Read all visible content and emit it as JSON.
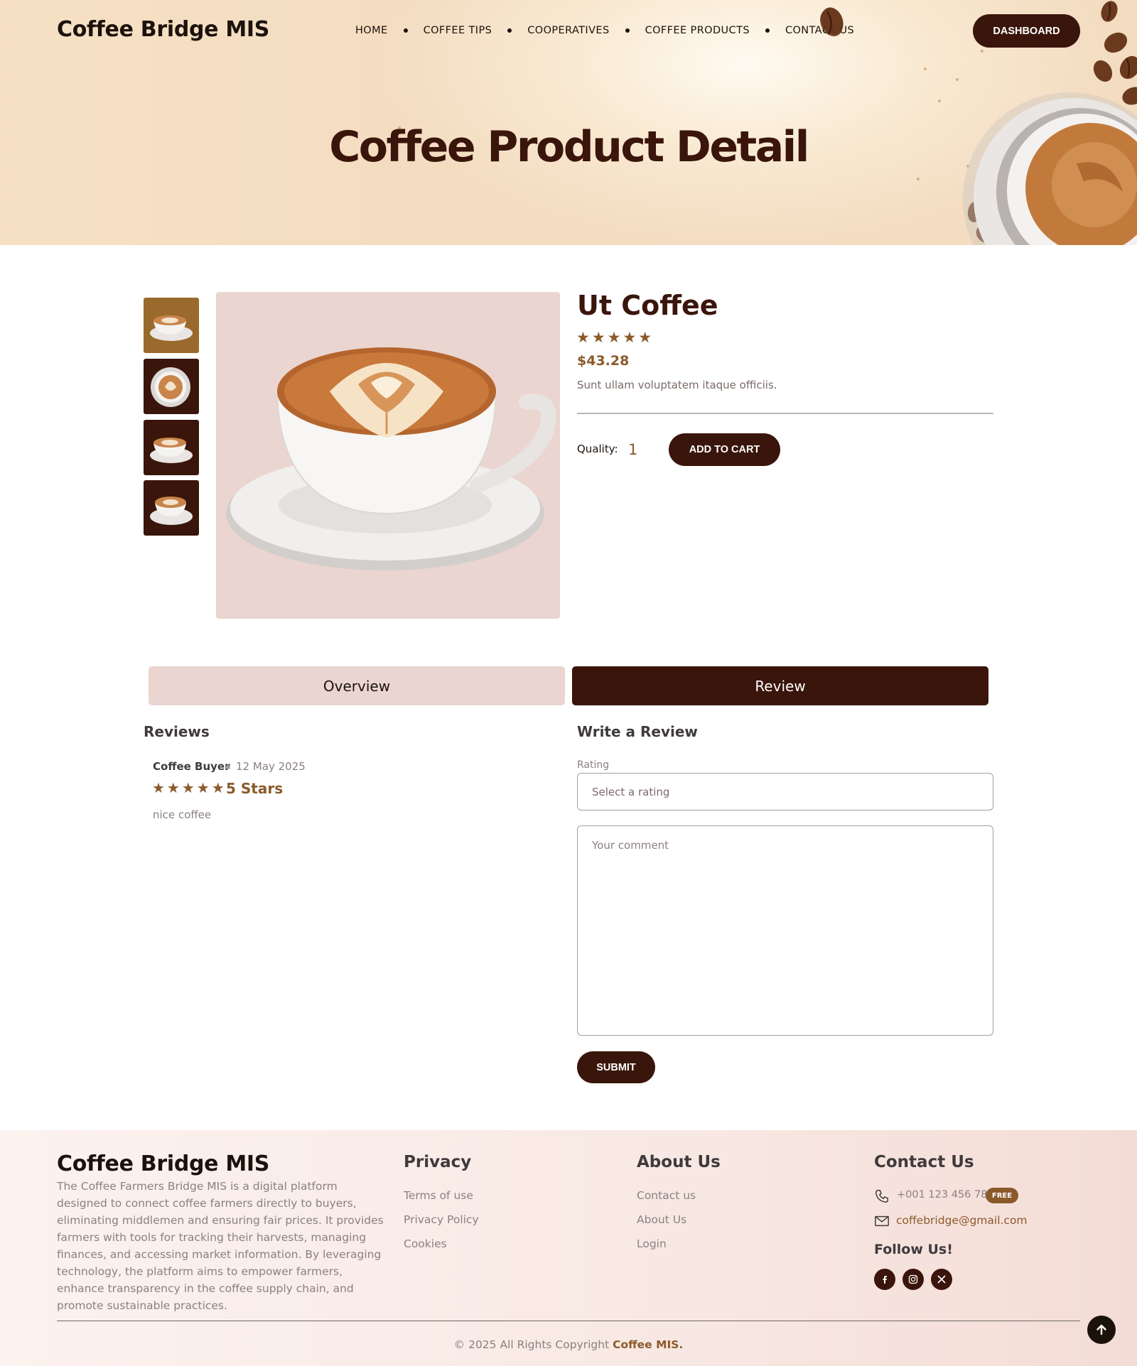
{
  "header": {
    "brand": "Coffee Bridge MIS",
    "nav": [
      "HOME",
      "COFFEE TIPS",
      "COOPERATIVES",
      "COFFEE PRODUCTS",
      "CONTACT US"
    ],
    "dashboard_label": "DASHBOARD",
    "page_title": "Coffee Product Detail"
  },
  "product": {
    "name": "Ut Coffee",
    "stars": "★★★★★",
    "price": "$43.28",
    "description": "Sunt ullam voluptatem itaque officiis.",
    "quantity_label": "Quality:",
    "quantity_value": "1",
    "add_to_cart_label": "ADD TO CART",
    "thumbnail_backgrounds": [
      "#9a6a2c",
      "#3a150b",
      "#3a150b",
      "#3a150b"
    ],
    "image_background": "#ead5d0"
  },
  "tabs": {
    "overview": "Overview",
    "review": "Review",
    "active": "Review"
  },
  "reviews": {
    "heading": "Reviews",
    "items": [
      {
        "author": "Coffee Buyer",
        "date": "12 May 2025",
        "stars": "★★★★★",
        "score": "5 Stars",
        "comment": "nice coffee"
      }
    ]
  },
  "review_form": {
    "heading": "Write a Review",
    "rating_label": "Rating",
    "rating_placeholder": "Select a rating",
    "comment_placeholder": "Your comment",
    "submit_label": "SUBMIT"
  },
  "footer": {
    "brand": "Coffee Bridge MIS",
    "about": "The Coffee Farmers Bridge MIS is a digital platform designed to connect coffee farmers directly to buyers, eliminating middlemen and ensuring fair prices. It provides farmers with tools for tracking their harvests, managing finances, and accessing market information. By leveraging technology, the platform aims to empower farmers, enhance transparency in the coffee supply chain, and promote sustainable practices.",
    "privacy": {
      "heading": "Privacy",
      "links": [
        "Terms of use",
        "Privacy Policy",
        "Cookies"
      ]
    },
    "about_us": {
      "heading": "About Us",
      "links": [
        "Contact us",
        "About Us",
        "Login"
      ]
    },
    "contact": {
      "heading": "Contact Us",
      "phone": "+001 123 456 789",
      "phone_badge": "FREE",
      "email": "coffebridge@gmail.com",
      "follow_label": "Follow Us!",
      "socials": [
        "facebook-icon",
        "instagram-icon",
        "x-icon"
      ]
    },
    "copyright_prefix": "© 2025 All Rights Copyright ",
    "copyright_brand": "Coffee MIS."
  },
  "colors": {
    "primary": "#3a150b",
    "accent": "#8b5a2b",
    "tab_inactive": "#ead5d0"
  }
}
